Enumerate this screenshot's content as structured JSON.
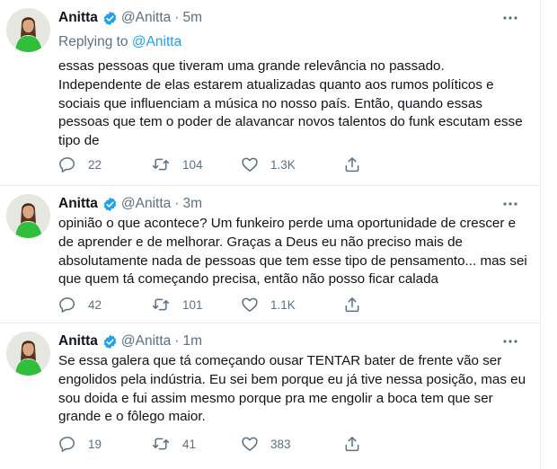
{
  "colors": {
    "verified": "#1da1f2",
    "muted": "#5b7083",
    "link": "#1da1f2",
    "text": "#0f1419",
    "divider": "#e6ecf0"
  },
  "tweets": [
    {
      "author": {
        "display_name": "Anitta",
        "handle": "@Anitta",
        "verified": true,
        "avatar_icon": "profile-photo"
      },
      "separator": "·",
      "time": "5m",
      "more_icon": "more-horizontal-icon",
      "replying_prefix": "Replying to ",
      "replying_to": "@Anitta",
      "text": "essas pessoas que tiveram uma grande relevância no passado.\nIndependente de elas estarem atualizadas quanto aos rumos políticos e sociais que influenciam a música no nosso país. Então, quando essas pessoas que tem o poder de alavancar novos talentos do funk escutam esse tipo de",
      "actions": {
        "reply": "22",
        "retweet": "104",
        "like": "1.3K"
      }
    },
    {
      "author": {
        "display_name": "Anitta",
        "handle": "@Anitta",
        "verified": true,
        "avatar_icon": "profile-photo"
      },
      "separator": "·",
      "time": "3m",
      "more_icon": "more-horizontal-icon",
      "text": "opinião o que acontece? Um funkeiro perde uma oportunidade de crescer e de aprender e de melhorar. Graças a Deus eu não preciso mais de absolutamente nada de pessoas que tem esse tipo de pensamento... mas sei que quem tá começando precisa, então não posso ficar calada",
      "actions": {
        "reply": "42",
        "retweet": "101",
        "like": "1.1K"
      }
    },
    {
      "author": {
        "display_name": "Anitta",
        "handle": "@Anitta",
        "verified": true,
        "avatar_icon": "profile-photo"
      },
      "separator": "·",
      "time": "1m",
      "more_icon": "more-horizontal-icon",
      "text": "Se essa galera que tá começando ousar TENTAR bater de frente vão ser engolidos pela indústria. Eu sei bem porque eu já tive nessa posição, mas eu sou doida e fui assim mesmo porque pra me engolir a boca tem que ser grande e o fôlego maior.",
      "actions": {
        "reply": "19",
        "retweet": "41",
        "like": "383"
      }
    }
  ]
}
